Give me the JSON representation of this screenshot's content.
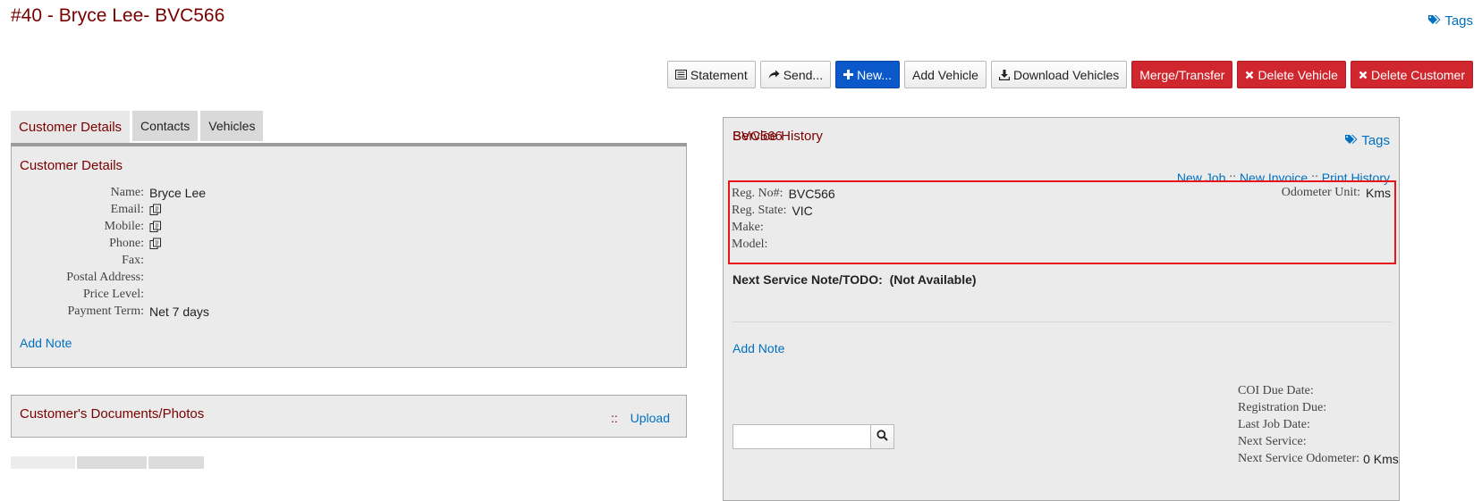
{
  "header": {
    "title": "#40 - Bryce Lee- BVC566",
    "tags_label": "Tags"
  },
  "toolbar": {
    "statement": "Statement",
    "send": "Send...",
    "new": "New...",
    "add_vehicle": "Add Vehicle",
    "download_vehicles": "Download Vehicles",
    "merge_transfer": "Merge/Transfer",
    "delete_vehicle": "Delete Vehicle",
    "delete_customer": "Delete Customer"
  },
  "tabs": [
    {
      "label": "Customer Details"
    },
    {
      "label": "Contacts"
    },
    {
      "label": "Vehicles"
    }
  ],
  "customer": {
    "heading": "Customer Details",
    "fields": [
      {
        "label": "Name:",
        "value": "Bryce Lee"
      },
      {
        "label": "Email:",
        "value": ""
      },
      {
        "label": "Mobile:",
        "value": ""
      },
      {
        "label": "Phone:",
        "value": ""
      },
      {
        "label": "Fax:",
        "value": ""
      },
      {
        "label": "Postal Address:",
        "value": ""
      },
      {
        "label": "Price Level:",
        "value": ""
      },
      {
        "label": "Payment Term:",
        "value": "Net 7 days"
      }
    ],
    "add_note": "Add Note"
  },
  "documents": {
    "heading": "Customer's Documents/Photos",
    "separator": "::",
    "upload": "Upload"
  },
  "vehicle": {
    "heading": "BVC566",
    "tags_label": "Tags",
    "links": {
      "new_job": "New Job",
      "new_invoice": "New Invoice",
      "print_history": "Print History",
      "separator": "::"
    },
    "reg_no_label": "Reg. No#:",
    "reg_no": "BVC566",
    "reg_state_label": "Reg. State:",
    "reg_state": "VIC",
    "make_label": "Make:",
    "make": "",
    "model_label": "Model:",
    "model": "",
    "odometer_unit_label": "Odometer Unit:",
    "odometer_unit": "Kms",
    "next_service_note": "Next Service Note/TODO:  (Not Available)",
    "add_note": "Add Note"
  },
  "service_history": {
    "heading": "Service History",
    "search_placeholder": "",
    "coi_due_label": "COI Due Date:",
    "registration_due_label": "Registration Due:",
    "last_job_label": "Last Job Date:",
    "next_service_label": "Next Service:",
    "next_service_odometer_label": "Next Service Odometer:",
    "next_service_odometer": "0 Kms"
  },
  "colors": {
    "heading": "#7a0000",
    "link": "#0070c0",
    "primary_button": "#0a58c9",
    "danger_button": "#d0262e",
    "highlight_box": "#e8141a"
  },
  "icons": [
    "tag-icon",
    "list-icon",
    "share-icon",
    "plus-icon",
    "download-icon",
    "times-icon",
    "copy-icon",
    "search-icon"
  ]
}
